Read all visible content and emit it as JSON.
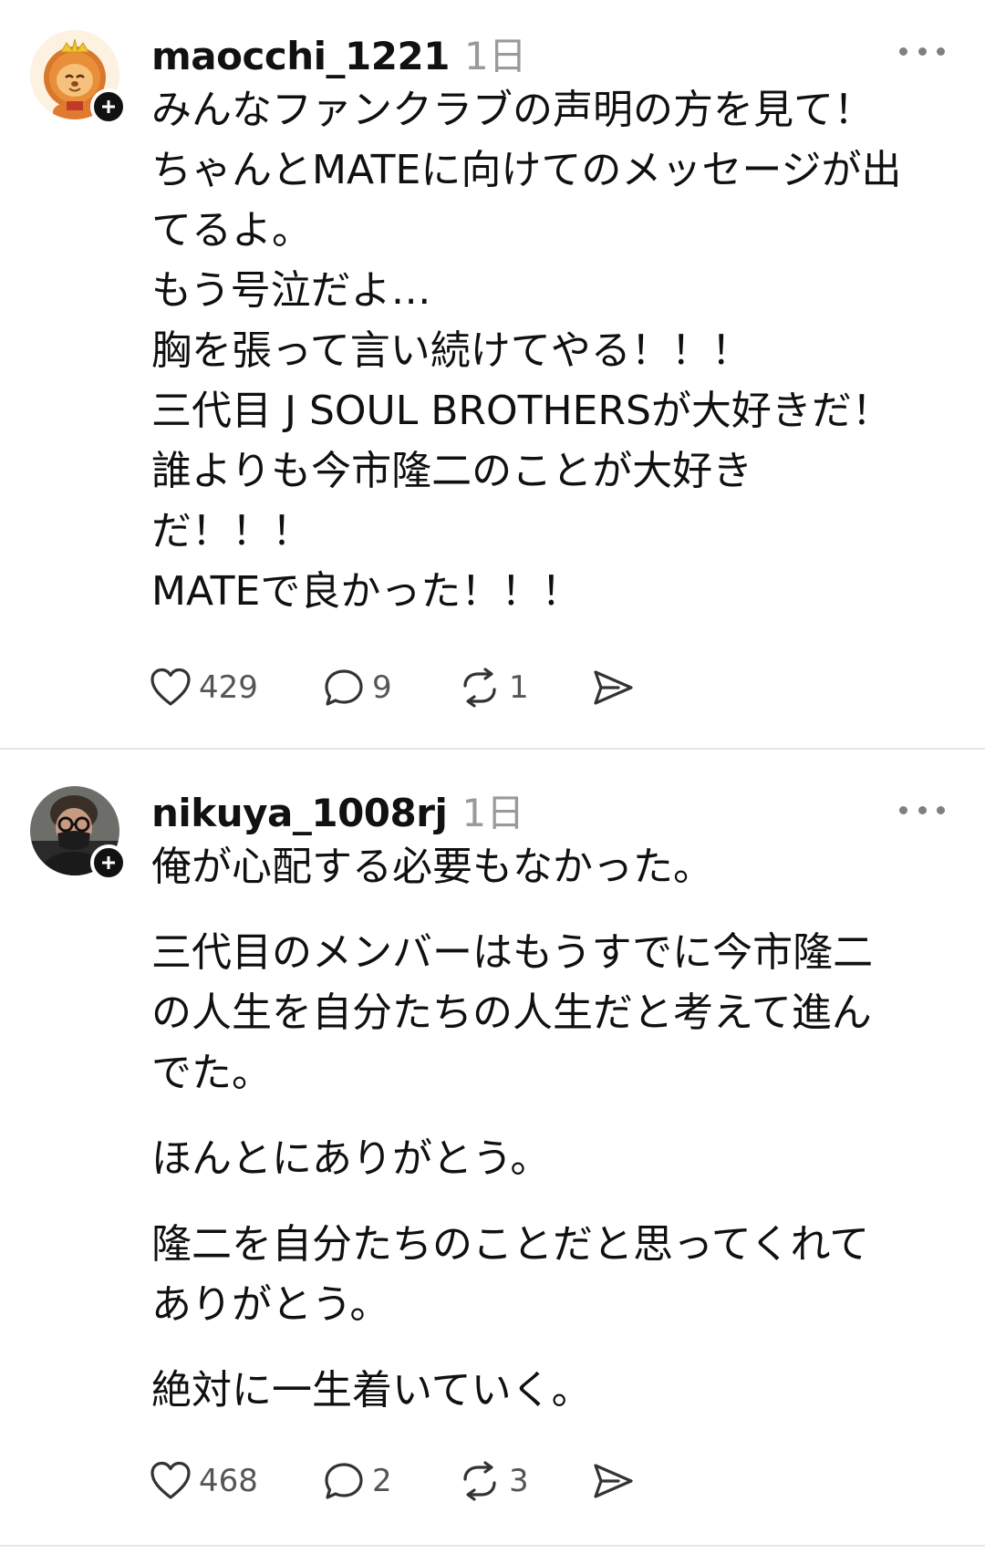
{
  "posts": [
    {
      "username": "maocchi_1221",
      "timestamp": "1日",
      "avatar_icon": "lion-character-avatar",
      "body_paragraphs": [
        [
          "みんなファンクラブの声明の方を見て！",
          "ちゃんとMATEに向けてのメッセージが出",
          "てるよ。",
          "もう号泣だよ…",
          "胸を張って言い続けてやる！！！",
          "三代目 J SOUL BROTHERSが大好きだ！",
          "誰よりも今市隆二のことが大好き",
          "だ！！！",
          "MATEで良かった！！！"
        ]
      ],
      "actions": {
        "likes": "429",
        "replies": "9",
        "reposts": "1"
      }
    },
    {
      "username": "nikuya_1008rj",
      "timestamp": "1日",
      "avatar_icon": "person-photo-avatar",
      "body_paragraphs": [
        [
          "俺が心配する必要もなかった。"
        ],
        [
          "三代目のメンバーはもうすでに今市隆二",
          "の人生を自分たちの人生だと考えて進ん",
          "でた。"
        ],
        [
          "ほんとにありがとう。"
        ],
        [
          "隆二を自分たちのことだと思ってくれて",
          "ありがとう。"
        ],
        [
          "絶対に一生着いていく。"
        ]
      ],
      "actions": {
        "likes": "468",
        "replies": "2",
        "reposts": "3"
      }
    }
  ],
  "colors": {
    "text": "#101010",
    "muted": "#9a9a9a",
    "action_text": "#555555",
    "divider": "#e6e6e6",
    "badge": "#111111"
  }
}
